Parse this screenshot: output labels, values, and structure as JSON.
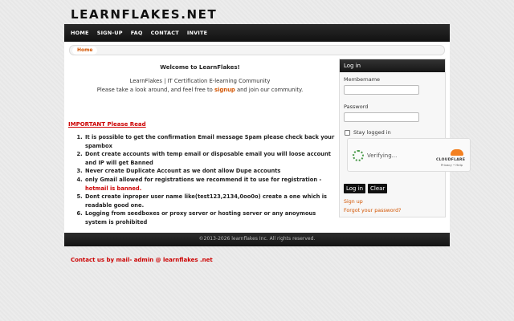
{
  "site": {
    "logo": "LEARNFLAKES.NET"
  },
  "nav": {
    "items": [
      "HOME",
      "SIGN-UP",
      "FAQ",
      "CONTACT",
      "INVITE"
    ]
  },
  "breadcrumb": {
    "home": "Home"
  },
  "main": {
    "welcome": "Welcome to LearnFlakes!",
    "community": "LearnFlakes | IT Certification E-learning Community",
    "look_prefix": "Please take a look around, and feel free to ",
    "signup_link": "signup",
    "look_suffix": " and join our community.",
    "important": "IMPORTANT Please Read",
    "rules": [
      "It is possible to get the confirmation Email message Spam please check back your spambox",
      "Dont create accounts with temp email or disposable email you will loose account and IP will get Banned",
      "Never create Duplicate Account as we dont allow Dupe accounts",
      " only Gmail allowed for registrations we recommend it to use for registration -",
      "Dont create inproper user name like(test123,2134,0oo0o) create a one which is readable good one.",
      "Logging from seedboxes or proxy server or hosting server or any anoymous system is prohibited"
    ],
    "rule4_red": "hotmail is banned.",
    "contact": "Contact us by mail- admin @ learnflakes .net"
  },
  "login": {
    "title": "Log in",
    "member_label": "Membername",
    "password_label": "Password",
    "stay_label": "Stay logged in",
    "captcha": {
      "status": "Verifying...",
      "brand": "CLOUDFLARE",
      "links": "Privacy • Help"
    },
    "login_button": "Log in",
    "clear_button": "Clear",
    "signup_link": "Sign up",
    "forgot_link": "Forgot your password?"
  },
  "footer": {
    "text": "©2013-2026 learnflakes Inc. All rights reserved."
  },
  "colors": {
    "accent": "#d35400",
    "warning": "#cc0000",
    "nav_bg": "#1c1c1c"
  }
}
